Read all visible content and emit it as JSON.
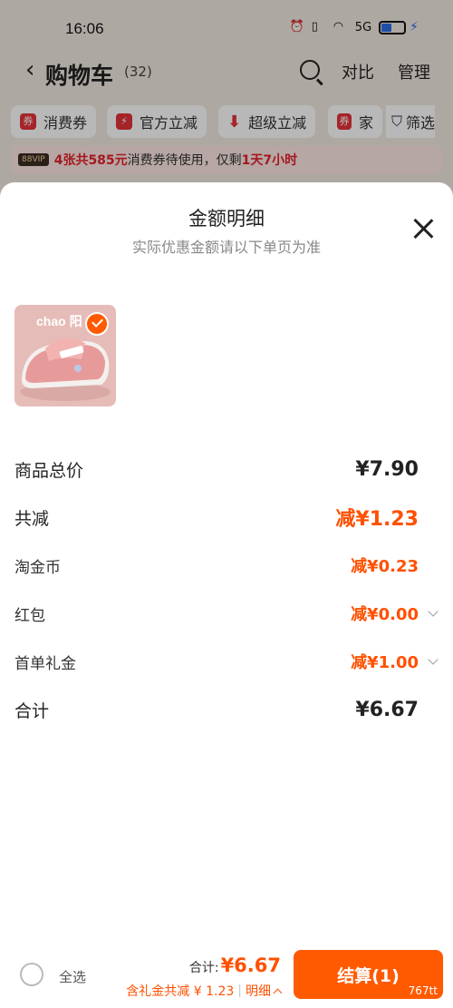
{
  "status_bar": {
    "time": "16:06",
    "network": "5G"
  },
  "nav": {
    "back_glyph": "‹",
    "title": "购物车",
    "count": "(32)",
    "compare": "对比",
    "manage": "管理"
  },
  "filters": {
    "chips": [
      {
        "label": "消费券",
        "icon": "coupon-icon"
      },
      {
        "label": "官方立减",
        "icon": "lightning-icon"
      },
      {
        "label": "超级立减",
        "icon": "arrow-down-icon"
      },
      {
        "label": "家",
        "icon": "coupon-icon"
      }
    ],
    "filter_label": "筛选"
  },
  "banner": {
    "badge": "88VIP",
    "highlight": "4张共585元",
    "mid": "消费券待使用，仅剩",
    "deadline": "1天7小时"
  },
  "sheet": {
    "title": "金额明细",
    "subtitle": "实际优惠金额请以下单页为准",
    "product_brand": "chao 阳",
    "rows": {
      "subtotal": {
        "label": "商品总价",
        "value": "¥7.90"
      },
      "total_discount": {
        "label": "共减",
        "value": "减¥1.23"
      },
      "taojinbi": {
        "label": "淘金币",
        "value": "减¥0.23"
      },
      "hongbao": {
        "label": "红包",
        "value": "减¥0.00"
      },
      "first_order_gift": {
        "label": "首单礼金",
        "value": "减¥1.00"
      },
      "total": {
        "label": "合计",
        "value": "¥6.67"
      }
    }
  },
  "bottom_bar": {
    "select_all": "全选",
    "total_label": "合计:",
    "total_amount": "¥6.67",
    "discount_note": "含礼金共减 ¥ 1.23",
    "separator": "|",
    "detail_link": "明细",
    "checkout_label": "结算(1)",
    "checkout_tag": "767tt"
  },
  "colors": {
    "accent": "#ff5000",
    "checkout": "#ff5a00",
    "promo_red": "#e5222b"
  }
}
